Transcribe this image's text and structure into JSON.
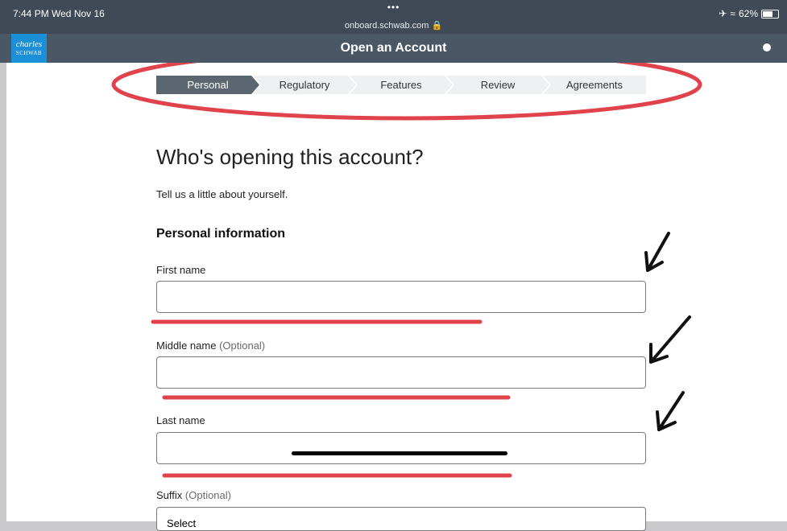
{
  "status": {
    "time": "7:44 PM  Wed Nov 16",
    "battery": "62%"
  },
  "browser": {
    "dots": "•••",
    "url": "onboard.schwab.com 🔒"
  },
  "header": {
    "logo_top": "charles",
    "logo_bottom": "SCHWAB",
    "title": "Open an Account"
  },
  "steps": [
    {
      "label": "Personal",
      "active": true
    },
    {
      "label": "Regulatory",
      "active": false
    },
    {
      "label": "Features",
      "active": false
    },
    {
      "label": "Review",
      "active": false
    },
    {
      "label": "Agreements",
      "active": false
    }
  ],
  "main": {
    "heading": "Who's opening this account?",
    "subtext": "Tell us a little about yourself.",
    "section_title": "Personal information",
    "fields": {
      "first_name": {
        "label": "First name",
        "optional": "",
        "value": ""
      },
      "middle_name": {
        "label": "Middle name",
        "optional": "(Optional)",
        "value": ""
      },
      "last_name": {
        "label": "Last name",
        "optional": "",
        "value": ""
      },
      "suffix": {
        "label": "Suffix",
        "optional": "(Optional)",
        "selected": "Select"
      }
    }
  },
  "colors": {
    "annotation_red": "#e0434c",
    "arrow": "#111111",
    "active_step": "#5b6670",
    "header": "#4a5866"
  }
}
